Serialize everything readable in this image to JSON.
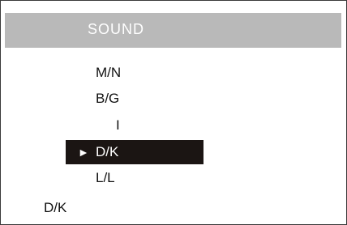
{
  "header": {
    "title": "SOUND"
  },
  "options": [
    {
      "label": "M/N",
      "selected": false
    },
    {
      "label": "B/G",
      "selected": false
    },
    {
      "label": "I",
      "selected": false
    },
    {
      "label": "D/K",
      "selected": true
    },
    {
      "label": "L/L",
      "selected": false
    }
  ],
  "selection_marker": "►",
  "current_value": "D/K",
  "colors": {
    "header_bg": "#b9b9b9",
    "header_text": "#ffffff",
    "highlight_bg": "#1b1513",
    "highlight_text": "#ffffff",
    "text": "#111111"
  }
}
